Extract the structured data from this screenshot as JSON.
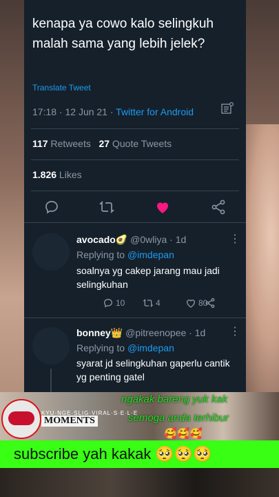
{
  "tweet": {
    "text": "kenapa ya cowo kalo selingkuh malah sama yang lebih jelek?",
    "translate": "Translate Tweet",
    "time": "17:18 · 12 Jun 21 · ",
    "source": "Twitter for Android",
    "retweets_count": "117",
    "retweets_label": " Retweets",
    "quotes_count": "27",
    "quotes_label": " Quote Tweets",
    "likes_count": "1.826",
    "likes_label": " Likes"
  },
  "replies": [
    {
      "name": "avocado",
      "handle": "@0wliya · 1d",
      "replying_prefix": "Replying to ",
      "replying_to": "@imdepan",
      "text": "soalnya yg cakep jarang mau jadi selingkuhan",
      "reply_count": "10",
      "retweet_count": "4",
      "like_count": "80"
    },
    {
      "name": "bonney",
      "handle": "@pitreenopee · 1d",
      "replying_prefix": "Replying to ",
      "replying_to": "@imdepan",
      "text": "syarat jd selingkuhan gaperlu cantik yg penting gatel"
    }
  ],
  "overlay": {
    "logo_caption": "KYU·NGE·SLIG·VIRAL·S·E·L·E",
    "brand": "MOMENTS",
    "promo_line1": "ngakak bareng yuk kak",
    "promo_line2": "semoga anda terhibur",
    "emoji_row": "🥰🥰🥰",
    "subscribe": "subscribe yah kakak 🥺🥺🥺"
  },
  "colors": {
    "like": "#f91880",
    "link": "#1d9bf0",
    "banner": "#39ff14"
  }
}
